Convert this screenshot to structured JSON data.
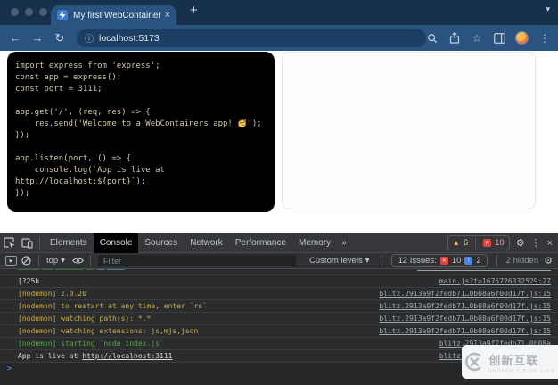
{
  "browser": {
    "tab_title": "My first WebContainers app",
    "url": "localhost:5173"
  },
  "editor": {
    "code_lines": [
      "import express from 'express';",
      "const app = express();",
      "const port = 3111;",
      "",
      "app.get('/', (req, res) => {",
      "    res.send('Welcome to a WebContainers app! 🥳');",
      "});",
      "",
      "app.listen(port, () => {",
      "    console.log(`App is live at",
      "http://localhost:${port}`);",
      "});"
    ]
  },
  "devtools": {
    "tabs": [
      "Elements",
      "Console",
      "Sources",
      "Network",
      "Performance",
      "Memory"
    ],
    "active_tab": "Console",
    "more_tabs_symbol": "»",
    "warning_count": "6",
    "error_count": "10",
    "toolbar": {
      "context_selector": "top",
      "filter_placeholder": "Filter",
      "levels_label": "Custom levels",
      "issues_label": "12 Issues:",
      "issues_error_count": "10",
      "issues_breaking_count": "2",
      "hidden_label": "2 hidden"
    },
    "console": {
      "clipped_row": {
        "green": "────── ─── ──────── ──",
        "teal": "── ─────"
      },
      "rows": [
        {
          "text": "[?25h",
          "color": "plain",
          "link": "main.js?t=1675726332529:27"
        },
        {
          "text": "[nodemon] 2.0.20",
          "color": "yellow",
          "link": "blitz.2913a9f2fedb71…0b08a6f00d17f.js:15"
        },
        {
          "text": "[nodemon] to restart at any time, enter `rs`",
          "color": "yellow",
          "link": "blitz.2913a9f2fedb71…0b08a6f00d17f.js:15"
        },
        {
          "text": "[nodemon] watching path(s): *.*",
          "color": "yellow",
          "link": "blitz.2913a9f2fedb71…0b08a6f00d17f.js:15"
        },
        {
          "text": "[nodemon] watching extensions: js,mjs,json",
          "color": "yellow",
          "link": "blitz.2913a9f2fedb71…0b08a6f00d17f.js:15"
        },
        {
          "text": "[nodemon] starting `node index.js`",
          "color": "green",
          "link": "blitz.2913a9f2fedb71…0b08a"
        },
        {
          "text": "App is live at ",
          "color": "plain",
          "inline_link": "http://localhost:3111",
          "link": "blitz.2913a9f2fedb71…0b08a"
        }
      ],
      "prompt_symbol": ">"
    }
  },
  "icons": {
    "back": "←",
    "forward": "→",
    "reload": "↻",
    "new_tab": "+",
    "tab_close": "×",
    "chevron_down": "▾",
    "info": "ⓘ",
    "star": "☆",
    "more_vertical": "⋮",
    "settings": "⚙",
    "close": "×",
    "warning": "▲",
    "dropdown": "▾",
    "play": "▶"
  },
  "colors": {
    "chrome_frame": "#17304c",
    "chrome_toolbar": "#2b5380",
    "console_yellow": "#ccab43",
    "console_green": "#55a545",
    "error_red": "#e0443e",
    "issue_blue": "#4285f4",
    "warning_yellow": "#f0b73f"
  },
  "watermark": {
    "brand": "创新互联",
    "subtitle": "CHUANG XIN HU LIAN"
  }
}
